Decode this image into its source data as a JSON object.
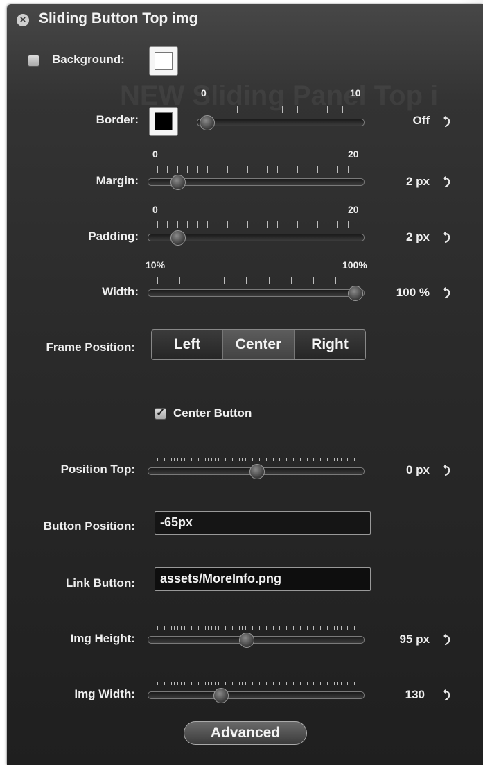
{
  "window": {
    "title": "Sliding Button Top img"
  },
  "background": {
    "label": "Background:",
    "checked": false
  },
  "border": {
    "label": "Border:",
    "value": "Off",
    "min_label": "0",
    "max_label": "10",
    "min": 0,
    "max": 10,
    "current": 0
  },
  "margin": {
    "label": "Margin:",
    "value": "2 px",
    "min_label": "0",
    "max_label": "20",
    "min": 0,
    "max": 20,
    "current": 2
  },
  "padding": {
    "label": "Padding:",
    "value": "2 px",
    "min_label": "0",
    "max_label": "20",
    "min": 0,
    "max": 20,
    "current": 2
  },
  "width": {
    "label": "Width:",
    "value": "100 %",
    "min_label": "10%",
    "max_label": "100%",
    "min": 10,
    "max": 100,
    "current": 100
  },
  "frame_position": {
    "label": "Frame Position:",
    "options": [
      "Left",
      "Center",
      "Right"
    ],
    "selected": "Center"
  },
  "center_button": {
    "label": "Center Button",
    "checked": true
  },
  "position_top": {
    "label": "Position Top:",
    "value": "0 px",
    "fraction": 0.5
  },
  "button_position": {
    "label": "Button Position:",
    "value": "-65px"
  },
  "link_button": {
    "label": "Link Button:",
    "value": "assets/MoreInfo.png"
  },
  "img_height": {
    "label": "Img Height:",
    "value": "95 px",
    "fraction": 0.45
  },
  "img_width": {
    "label": "Img Width:",
    "value": "130",
    "fraction": 0.32
  },
  "advanced_button": {
    "label": "Advanced"
  },
  "colors": {
    "panel": "#2a2a2a",
    "text": "#f0f0f0",
    "swatch_background": "#ffffff",
    "swatch_border": "#000000"
  },
  "icons": {
    "close": "close-icon",
    "reset": "reset-arrow-icon"
  }
}
